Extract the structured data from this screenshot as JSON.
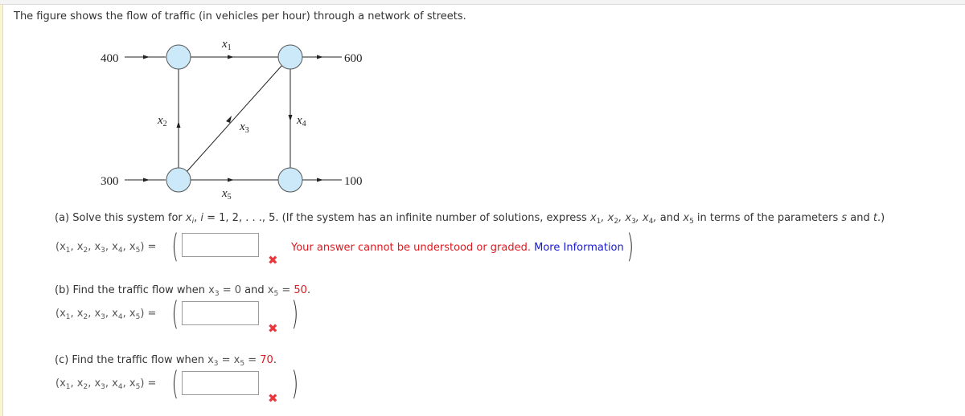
{
  "intro": "The figure shows the flow of traffic (in vehicles per hour) through a network of streets.",
  "diagram": {
    "inflow_top_left": "400",
    "inflow_bottom_left": "300",
    "outflow_top_right": "600",
    "outflow_bottom_right": "100",
    "edges": [
      {
        "label": "x",
        "sub": "1",
        "from": "top-left",
        "to": "top-right"
      },
      {
        "label": "x",
        "sub": "2",
        "from": "bottom-left",
        "to": "top-left"
      },
      {
        "label": "x",
        "sub": "3",
        "from": "bottom-left",
        "to": "top-right"
      },
      {
        "label": "x",
        "sub": "4",
        "from": "top-right",
        "to": "bottom-right"
      },
      {
        "label": "x",
        "sub": "5",
        "from": "bottom-left",
        "to": "bottom-right"
      }
    ],
    "node_color": "#cce9f9"
  },
  "part_a": {
    "prompt_start": "(a) Solve this system for ",
    "prompt_var": "x",
    "prompt_sub": "i",
    "prompt_mid": ", ",
    "prompt_i": "i",
    "prompt_range": " = 1, 2, . . ., 5. (If the system has an infinite number of solutions, express ",
    "prompt_vars": "x1, x2, x3, x4, and x5",
    "prompt_end_1": " in terms of the parameters ",
    "param_s": "s",
    "prompt_and": " and ",
    "param_t": "t",
    "prompt_end_2": ".)",
    "answer_label": "(x1, x2, x3, x4, x5) =",
    "answer_value": "",
    "error_text": "Your answer cannot be understood or graded.",
    "more_info_link": "More Information",
    "status": "incorrect"
  },
  "part_b": {
    "prompt_start": "(b) Find the traffic flow when ",
    "cond_1": "x3 = 0",
    "and": " and ",
    "cond_2_var": "x5 = ",
    "cond_2_value": "50",
    "period": ".",
    "answer_label": "(x1, x2, x3, x4, x5) =",
    "answer_value": "",
    "status": "incorrect"
  },
  "part_c": {
    "prompt_start": "(c) Find the traffic flow when ",
    "cond_var": "x3 = x5 = ",
    "cond_value": "70",
    "period": ".",
    "answer_label": "(x1, x2, x3, x4, x5) =",
    "answer_value": "",
    "status": "incorrect"
  },
  "icons": {
    "incorrect": "✖"
  },
  "colors": {
    "error": "#e0181f",
    "link": "#1a1acc",
    "incorrect_mark": "#e8383d"
  }
}
